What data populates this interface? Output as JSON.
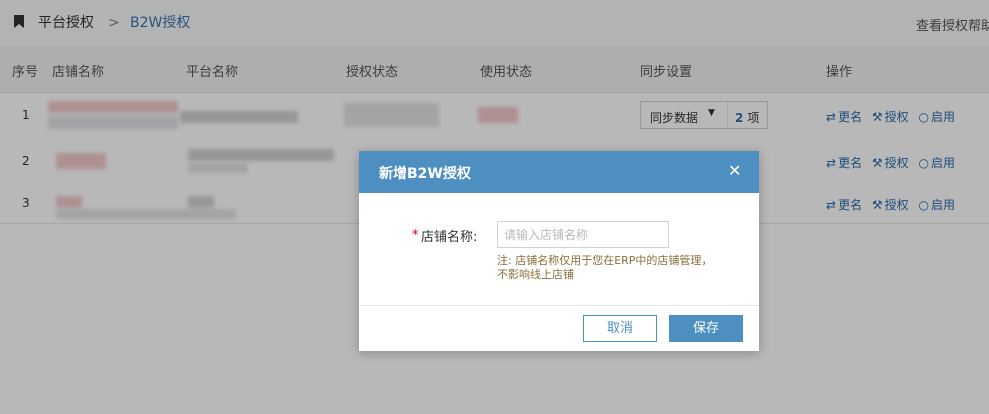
{
  "breadcrumb": {
    "icon": "bookmark-icon",
    "items": [
      "平台授权",
      ">",
      "B2W授权"
    ],
    "help_link": "查看授权帮助"
  },
  "table": {
    "headers": [
      "序号",
      "店铺名称",
      "平台名称",
      "授权状态",
      "使用状态",
      "同步设置",
      "操作"
    ],
    "rows": [
      {
        "index": "1",
        "sync_label": "同步数据",
        "sync_count": "2",
        "sync_unit": "项"
      },
      {
        "index": "2"
      },
      {
        "index": "3"
      }
    ],
    "actions": {
      "rename": "更名",
      "authorize": "授权",
      "enable": "启用"
    }
  },
  "dialog": {
    "title": "新增B2W授权",
    "close_icon": "close-icon",
    "field_label": "店铺名称:",
    "required_mark": "*",
    "input_placeholder": "请输入店铺名称",
    "input_value": "",
    "note": "注: 店铺名称仅用于您在ERP中的店铺管理，不影响线上店铺",
    "cancel_label": "取消",
    "save_label": "保存"
  },
  "colors": {
    "primary": "#4e8fc2",
    "link": "#2e6aa8",
    "note": "#8a6d3b",
    "required": "#d0021b"
  }
}
